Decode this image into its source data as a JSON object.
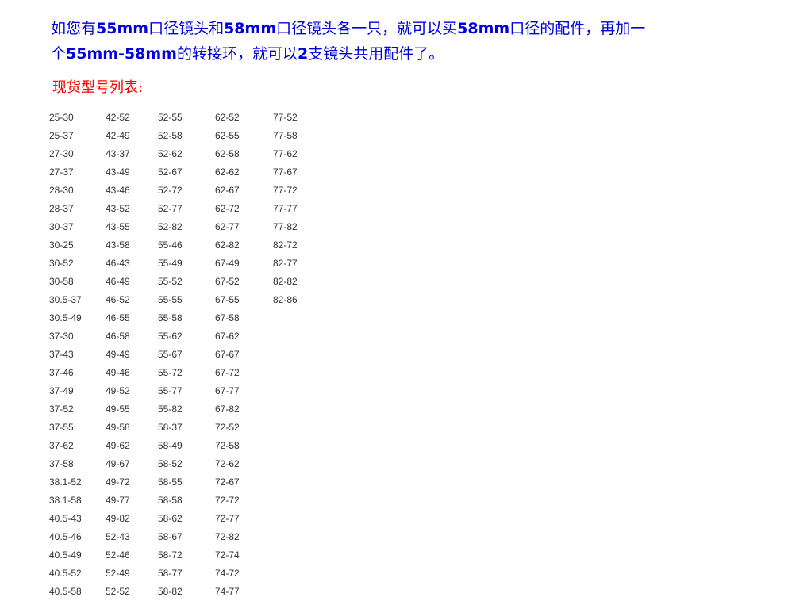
{
  "intro": {
    "s1": "如您有",
    "b1": "55mm",
    "s2": "口径镜头和",
    "b2": "58mm",
    "s3": "口径镜头各一只，就可以买",
    "b3": "58mm",
    "s4": "口径的配件，再加一",
    "s5": "个",
    "b4": "55mm-58mm",
    "s6": "的转接环，就可以",
    "b5": "2",
    "s7": "支镜头共用配件了。"
  },
  "heading": "现货型号列表:",
  "models": [
    [
      "25-30",
      "25-37",
      "27-30",
      "27-37",
      "28-30",
      "28-37",
      "30-37",
      "30-25",
      "30-52",
      "30-58",
      "30.5-37",
      "30.5-49",
      "37-30",
      "37-43",
      "37-46",
      "37-49",
      "37-52",
      "37-55",
      "37-62",
      "37-58",
      "38.1-52",
      "38.1-58",
      "40.5-43",
      "40.5-46",
      "40.5-49",
      "40.5-52",
      "40.5-58"
    ],
    [
      "42-52",
      "42-49",
      "43-37",
      "43-49",
      "43-46",
      "43-52",
      "43-55",
      "43-58",
      "46-43",
      "46-49",
      "46-52",
      "46-55",
      "46-58",
      "49-49",
      "49-46",
      "49-52",
      "49-55",
      "49-58",
      "49-62",
      "49-67",
      "49-72",
      "49-77",
      "49-82",
      "52-43",
      "52-46",
      "52-49",
      "52-52"
    ],
    [
      "52-55",
      "52-58",
      "52-62",
      "52-67",
      "52-72",
      "52-77",
      "52-82",
      "55-46",
      "55-49",
      "55-52",
      "55-55",
      "55-58",
      "55-62",
      "55-67",
      "55-72",
      "55-77",
      "55-82",
      "58-37",
      "58-49",
      "58-52",
      "58-55",
      "58-58",
      "58-62",
      "58-67",
      "58-72",
      "58-77",
      "58-82"
    ],
    [
      "62-52",
      "62-55",
      "62-58",
      "62-62",
      "62-67",
      "62-72",
      "62-77",
      "62-82",
      "67-49",
      "67-52",
      "67-55",
      "67-58",
      "67-62",
      "67-67",
      "67-72",
      "67-77",
      "67-82",
      "72-52",
      "72-58",
      "72-62",
      "72-67",
      "72-72",
      "72-77",
      "72-82",
      "72-74",
      "74-72",
      "74-77"
    ],
    [
      "77-52",
      "77-58",
      "77-62",
      "77-67",
      "77-72",
      "77-77",
      "77-82",
      "82-72",
      "82-77",
      "82-82",
      "82-86"
    ]
  ]
}
